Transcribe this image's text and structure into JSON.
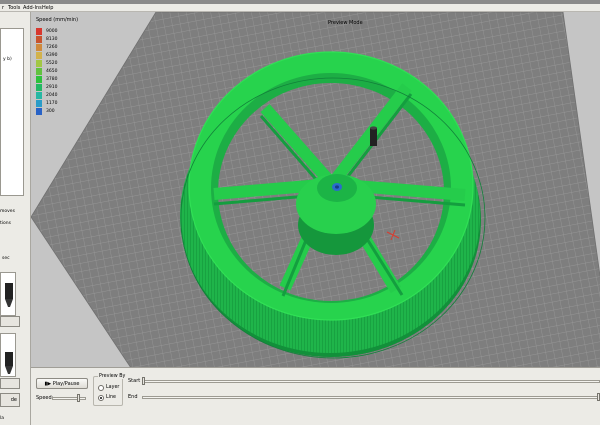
{
  "menu": {
    "items": [
      "r",
      "Tools",
      "Add-Ins",
      "Help"
    ]
  },
  "left_panel": {
    "tree_label": "y b)",
    "moves_label": "moves",
    "options_label": "tions",
    "time_label": "sec",
    "thumb1_button": "",
    "thumb2_button": "",
    "bottom_button": "de",
    "bottom_text": "la"
  },
  "viewport": {
    "mode_label": "Preview Mode",
    "legend": {
      "title": "Speed (mm/min)",
      "rows": [
        {
          "value": "9000",
          "color": "#d8372e"
        },
        {
          "value": "8130",
          "color": "#c8542e"
        },
        {
          "value": "7260",
          "color": "#cf8a3d"
        },
        {
          "value": "6390",
          "color": "#d2b24c"
        },
        {
          "value": "5520",
          "color": "#a2c744"
        },
        {
          "value": "4650",
          "color": "#62c23f"
        },
        {
          "value": "3780",
          "color": "#2ec23c"
        },
        {
          "value": "2910",
          "color": "#23b863"
        },
        {
          "value": "2040",
          "color": "#26b7a3"
        },
        {
          "value": "1170",
          "color": "#2a9cc8"
        },
        {
          "value": "300",
          "color": "#2862c6"
        }
      ]
    }
  },
  "controls": {
    "play_pause_label": "Play/Pause",
    "speed_label": "Speed:",
    "preview_by_label": "Preview By",
    "layer_label": "Layer",
    "line_label": "Line",
    "selected_mode": "line",
    "start_label": "Start",
    "end_label": "End",
    "start_level": 0.0,
    "end_level": 1.0,
    "speed_level": 0.8
  },
  "colors": {
    "model_green": "#26cf4a",
    "model_dark": "#139b39",
    "grid_bg": "#7f7f7f",
    "grid_line": "#9b9b9b"
  }
}
